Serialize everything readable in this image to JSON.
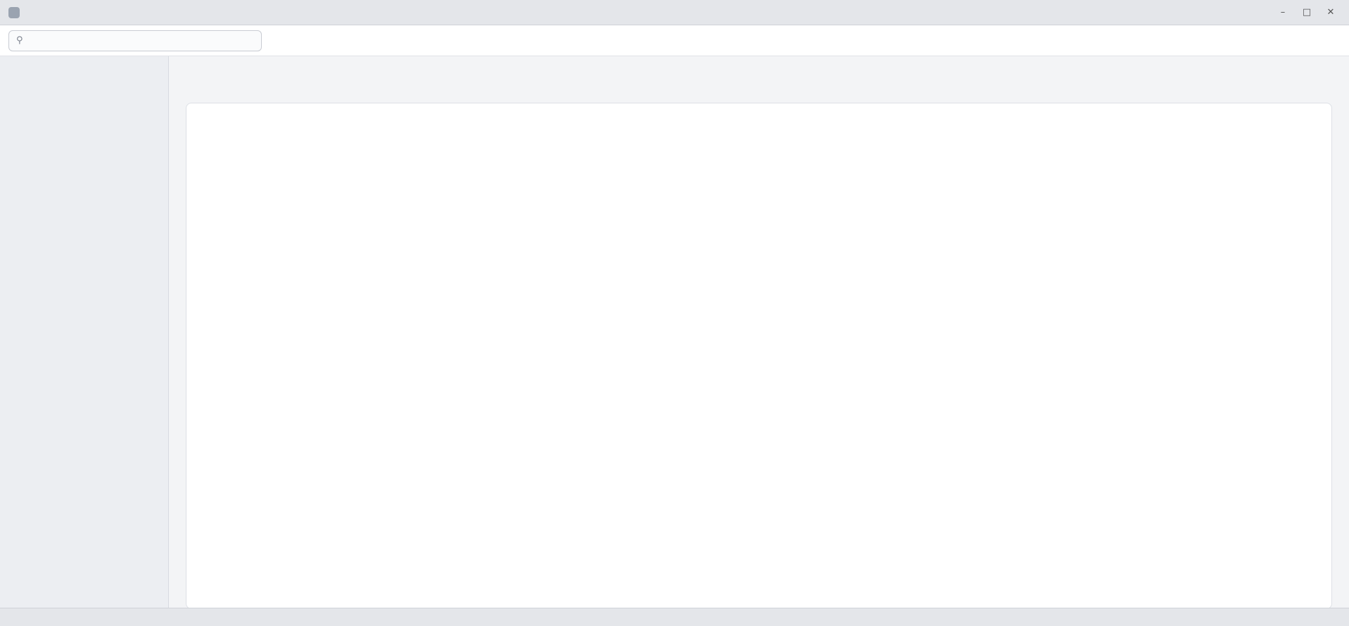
{
  "window": {
    "title": ""
  },
  "toolbar": {
    "search_placeholder": ""
  },
  "sidebar": {
    "items": []
  },
  "main": {
    "page_title": ""
  },
  "statusbar": {
    "text": ""
  }
}
